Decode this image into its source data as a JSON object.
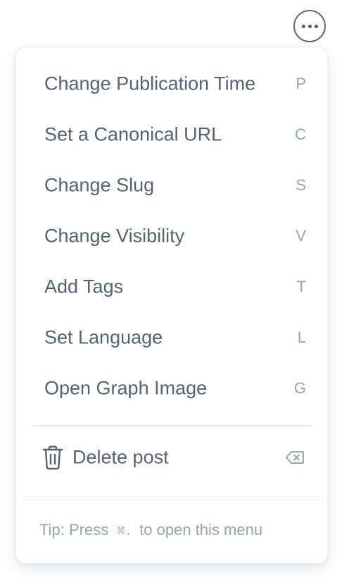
{
  "more_button": {
    "icon": "more-horizontal-icon"
  },
  "menu": {
    "items": [
      {
        "label": "Change Publication Time",
        "shortcut": "P"
      },
      {
        "label": "Set a Canonical URL",
        "shortcut": "C"
      },
      {
        "label": "Change Slug",
        "shortcut": "S"
      },
      {
        "label": "Change Visibility",
        "shortcut": "V"
      },
      {
        "label": "Add Tags",
        "shortcut": "T"
      },
      {
        "label": "Set Language",
        "shortcut": "L"
      },
      {
        "label": "Open Graph Image",
        "shortcut": "G"
      }
    ],
    "delete": {
      "label": "Delete post",
      "icon": "trash-icon",
      "shortcut_icon": "backspace-icon"
    },
    "tip": {
      "prefix": "Tip: Press",
      "keys": "⌘.",
      "suffix": "to open this menu"
    }
  },
  "colors": {
    "text": "#546377",
    "muted": "#9aa3af",
    "border": "#e2e5e9"
  }
}
